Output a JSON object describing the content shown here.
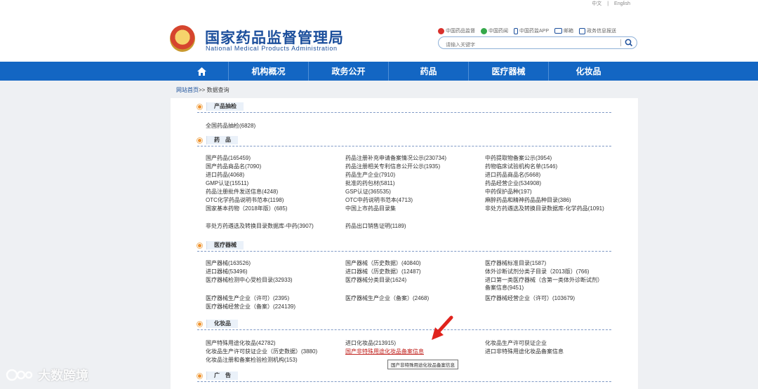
{
  "lang": {
    "cn": "中文",
    "sep": "|",
    "en": "English"
  },
  "site": {
    "title_cn": "国家药品监督管理局",
    "title_en": "National Medical Products Administration"
  },
  "quick_links": [
    {
      "label": "中国药品监督",
      "icon": "weibo-icon",
      "color": "#d9302b"
    },
    {
      "label": "中国药闻",
      "icon": "wechat-icon",
      "color": "#35a84a"
    },
    {
      "label": "中国药监APP",
      "icon": "mobile-app-icon",
      "color": "#1c4f9c"
    },
    {
      "label": "邮箱",
      "icon": "mail-icon",
      "color": "#1c4f9c"
    },
    {
      "label": "政务信息报送",
      "icon": "report-icon",
      "color": "#1c4f9c"
    }
  ],
  "search": {
    "placeholder": "请输入关键字"
  },
  "nav": {
    "home_icon": "home-icon",
    "items": [
      "机构概况",
      "政务公开",
      "药品",
      "医疗器械",
      "化妆品"
    ]
  },
  "breadcrumb": {
    "home": "网站首页",
    "sep": ">>",
    "current": "数据查询"
  },
  "sections": {
    "sampling": {
      "title": "产品抽检",
      "items": [
        "全国药品抽检(6828)"
      ]
    },
    "drugs": {
      "title": "药　品",
      "col1": [
        "国产药品(165459)",
        "国产药品商品名(7090)",
        "进口药品(4068)",
        "GMP认证(15511)",
        "药品注册批件发送信息(4248)",
        "OTC化学药品说明书范本(1198)",
        "国家基本药物（2018年版）(685)",
        "非处方药遴选及转换目录数据库-中药(3907)"
      ],
      "col2": [
        "药品注册补充申请备案情况公示(230734)",
        "药品注册相关专利信息公开公示(1935)",
        "药品生产企业(7910)",
        "批准的药包材(5811)",
        "GSP认证(365535)",
        "OTC中药说明书范本(4713)",
        "中国上市药品目录集",
        "药品出口销售证明(1189)"
      ],
      "col3": [
        "中药提取物备案公示(3954)",
        "药物临床试验机构名单(1546)",
        "进口药品商品名(5668)",
        "药品经营企业(534908)",
        "中药保护品种(197)",
        "麻醉药品和精神药品品种目录(386)",
        "非处方药遴选及转换目录数据库-化学药品(1091)"
      ]
    },
    "devices": {
      "title": "医疗器械",
      "col1": [
        "国产器械(163526)",
        "进口器械(53496)",
        "医疗器械检测中心受检目录(32933)",
        "医疗器械生产企业（许可）(2395)",
        "医疗器械经营企业（备案）(224139)"
      ],
      "col2": [
        "国产器械（历史数据）(40840)",
        "进口器械（历史数据）(12487)",
        "医疗器械分类目录(1624)",
        "医疗器械生产企业（备案）(2468)"
      ],
      "col3": [
        "医疗器械标准目录(1587)",
        "体外诊断试剂分类子目录（2013版）(766)",
        "进口第一类医疗器械（含第一类体外诊断试剂）备案信息(9451)",
        "医疗器械经营企业（许可）(103679)"
      ]
    },
    "cosmetics": {
      "title": "化妆品",
      "col1": [
        "国产特殊用途化妆品(42782)",
        "化妆品生产许可获证企业（历史数据）(3880)",
        "化妆品注册和备案检验检测机构(153)"
      ],
      "col2": [
        "进口化妆品(213915)",
        "国产非特殊用途化妆品备案信息"
      ],
      "col3": [
        "化妆品生产许可获证企业",
        "进口非特殊用途化妆品备案信息"
      ]
    },
    "ads": {
      "title": "广　告"
    }
  },
  "tooltip": "国产非特殊用途化妆品备案信息",
  "watermark": "大数跨境",
  "colors": {
    "nav_blue": "#1366c3",
    "brand_blue": "#1c4f9c",
    "accent_orange": "#f0922d",
    "highlight_red": "#c0201c"
  }
}
